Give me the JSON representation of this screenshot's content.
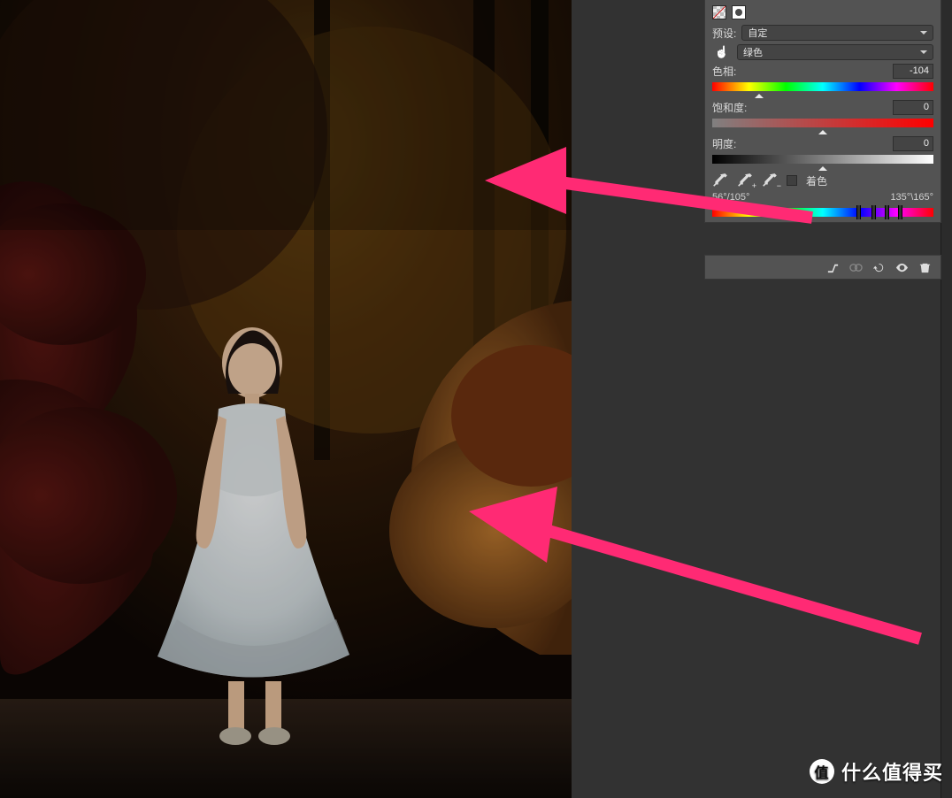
{
  "panel": {
    "preset_label": "预设:",
    "preset_value": "自定",
    "channel_value": "绿色",
    "hue_label": "色相:",
    "hue_value": "-104",
    "hue_thumb_pct": 21,
    "sat_label": "饱和度:",
    "sat_value": "0",
    "sat_thumb_pct": 50,
    "light_label": "明度:",
    "light_value": "0",
    "light_thumb_pct": 50,
    "colorize_label": "着色",
    "range_left": "56°/105°",
    "range_right": "135°\\165°",
    "range_markers_pct": [
      65,
      72,
      78,
      84
    ]
  },
  "icons": {
    "hand": "hand-icon",
    "eyedropper": "eyedropper-icon",
    "eyedropper_add": "eyedropper-add-icon",
    "eyedropper_sub": "eyedropper-sub-icon",
    "clip": "clip-mask-icon",
    "prev": "view-previous-icon",
    "reset": "reset-icon",
    "visible": "visibility-icon",
    "trash": "trash-icon"
  },
  "watermark": {
    "badge": "值",
    "text": "什么值得买"
  }
}
